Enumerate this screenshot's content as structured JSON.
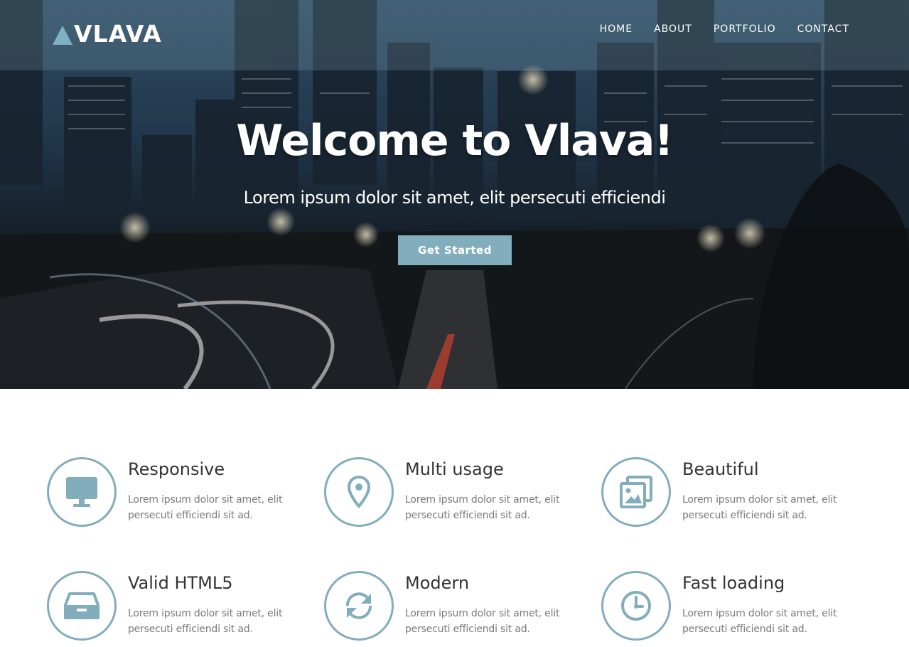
{
  "brand": {
    "name": "VLAVA",
    "accent": "#82adbc",
    "logo_color": "#7fb0c3"
  },
  "nav": {
    "items": [
      "HOME",
      "ABOUT",
      "PORTFOLIO",
      "CONTACT"
    ]
  },
  "hero": {
    "title": "Welcome to Vlava!",
    "subtitle": "Lorem ipsum dolor sit amet, elit persecuti efficiendi",
    "cta_label": "Get Started"
  },
  "features": [
    {
      "title": "Responsive",
      "text": "Lorem ipsum dolor sit amet, elit persecuti efficiendi sit ad.",
      "icon": "monitor-icon"
    },
    {
      "title": "Multi usage",
      "text": "Lorem ipsum dolor sit amet, elit persecuti efficiendi sit ad.",
      "icon": "map-pin-icon"
    },
    {
      "title": "Beautiful",
      "text": "Lorem ipsum dolor sit amet, elit persecuti efficiendi sit ad.",
      "icon": "images-icon"
    },
    {
      "title": "Valid HTML5",
      "text": "Lorem ipsum dolor sit amet, elit persecuti efficiendi sit ad.",
      "icon": "inbox-tray-icon"
    },
    {
      "title": "Modern",
      "text": "Lorem ipsum dolor sit amet, elit persecuti efficiendi sit ad.",
      "icon": "sync-arrows-icon"
    },
    {
      "title": "Fast loading",
      "text": "Lorem ipsum dolor sit amet, elit persecuti efficiendi sit ad.",
      "icon": "clock-icon"
    }
  ]
}
